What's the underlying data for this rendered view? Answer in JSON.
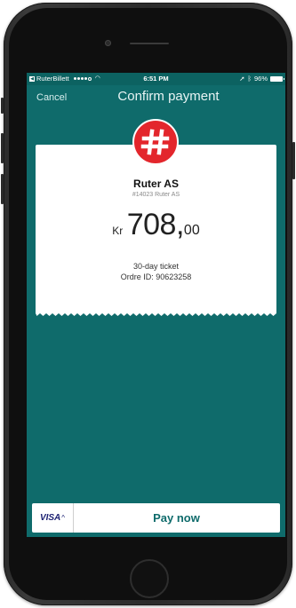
{
  "status_bar": {
    "carrier": "RuterBillett",
    "time": "6:51 PM",
    "battery": "96%"
  },
  "nav": {
    "cancel_label": "Cancel",
    "title": "Confirm payment"
  },
  "receipt": {
    "merchant_name": "Ruter AS",
    "merchant_subtitle": "#14023 Ruter AS",
    "currency": "Kr",
    "amount_main": "708,",
    "amount_cents": "00",
    "description": "30-day ticket",
    "order_id": "Ordre ID: 90623258"
  },
  "payment": {
    "card_brand": "VISA",
    "pay_label": "Pay now"
  },
  "icons": {
    "back": "back-arrow-icon",
    "wifi": "wifi-icon",
    "location": "location-arrow-icon",
    "bluetooth": "bluetooth-icon",
    "battery": "battery-icon",
    "logo": "ruter-hash-logo-icon",
    "caret": "chevron-up-icon"
  },
  "colors": {
    "screen_bg": "#0f6b6b",
    "logo_red": "#e3262c",
    "visa_blue": "#1a1f71"
  }
}
